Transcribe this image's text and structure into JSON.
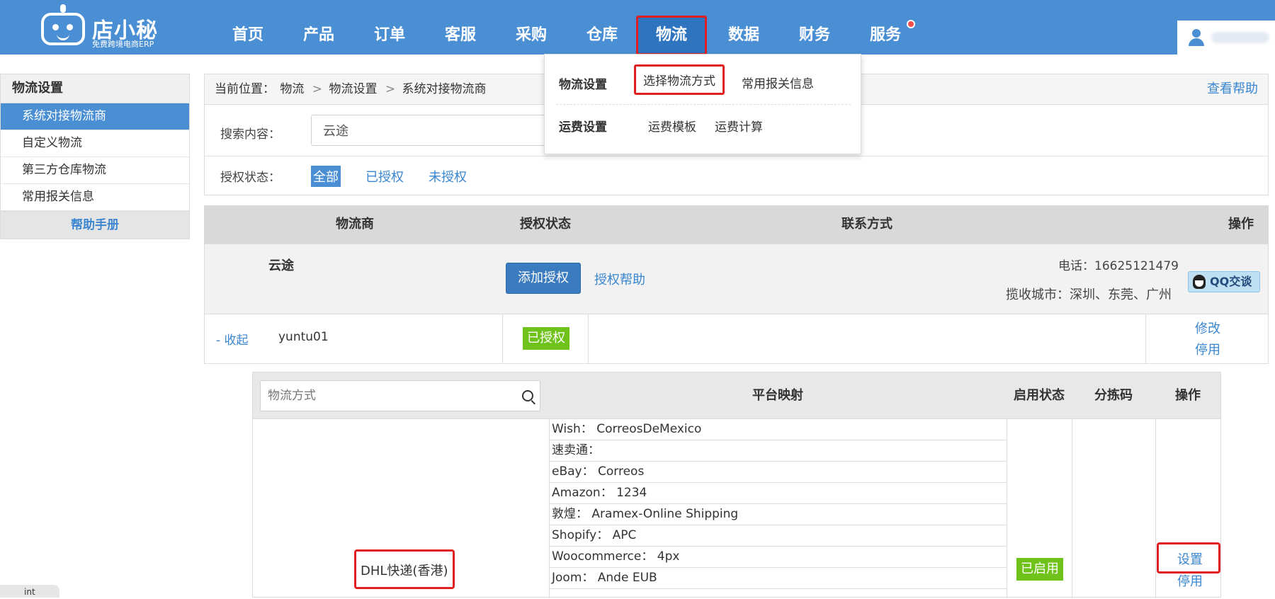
{
  "logo": {
    "title": "店小秘",
    "subtitle": "免费跨境电商ERP"
  },
  "nav": {
    "items": [
      "首页",
      "产品",
      "订单",
      "客服",
      "采购",
      "仓库",
      "物流",
      "数据",
      "财务",
      "服务"
    ],
    "active": "物流"
  },
  "sidebar": {
    "title": "物流设置",
    "items": [
      "系统对接物流商",
      "自定义物流",
      "第三方仓库物流",
      "常用报关信息"
    ],
    "active": "系统对接物流商",
    "help": "帮助手册"
  },
  "breadcrumb": {
    "prefix": "当前位置：",
    "path": [
      "物流",
      "物流设置",
      "系统对接物流商"
    ],
    "help": "查看帮助"
  },
  "filter": {
    "search_label": "搜索内容：",
    "search_value": "云途",
    "auth_label": "授权状态：",
    "auth_options": [
      "全部",
      "已授权",
      "未授权"
    ],
    "auth_active": "全部"
  },
  "dropdown": {
    "sections": [
      {
        "label": "物流设置",
        "links": [
          "选择物流方式",
          "常用报关信息"
        ]
      },
      {
        "label": "运费设置",
        "links": [
          "运费模板",
          "运费计算"
        ]
      }
    ]
  },
  "carrier_table": {
    "headers": [
      "物流商",
      "授权状态",
      "联系方式",
      "操作"
    ],
    "carrier": {
      "name": "云途",
      "add_auth": "添加授权",
      "auth_help": "授权帮助",
      "phone": "电话：16625121479",
      "cities": "揽收城市：深圳、东莞、广州",
      "qq": "QQ交谈"
    },
    "account": {
      "collapse": "- 收起",
      "name": "yuntu01",
      "status": "已授权",
      "actions": [
        "修改",
        "停用"
      ]
    }
  },
  "method_table": {
    "search_placeholder": "物流方式",
    "headers": [
      "平台映射",
      "启用状态",
      "分拣码",
      "操作"
    ],
    "method": "DHL快递(香港)",
    "mappings": [
      "Wish： CorreosDeMexico",
      "速卖通：",
      "eBay： Correos",
      "Amazon： 1234",
      "敦煌： Aramex-Online Shipping",
      "Shopify： APC",
      "Woocommerce： 4px",
      "Joom： Ande EUB"
    ],
    "status": "已启用",
    "actions": [
      "设置",
      "停用"
    ]
  },
  "bottom_tab": "int",
  "colors": {
    "primary": "#4a8fd4",
    "highlight": "#e02020",
    "success": "#6fc21a",
    "link": "#3b86d0"
  }
}
